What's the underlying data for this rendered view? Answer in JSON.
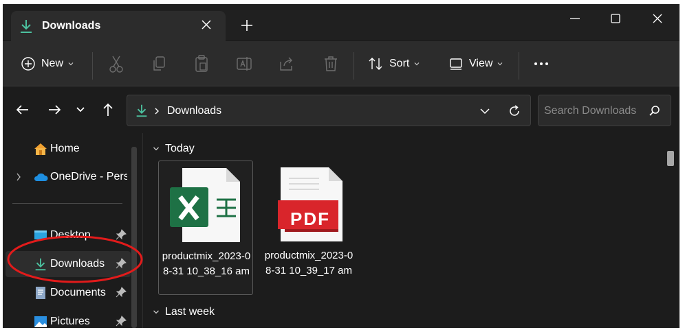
{
  "colors": {
    "accent": "#4cc2a0",
    "window_bg": "#1c1c1c",
    "annotation": "#e21b1b",
    "excel_green": "#1e7145",
    "pdf_red": "#d9252b"
  },
  "titlebar": {
    "tab_title": "Downloads",
    "tab_icon": "download-icon",
    "close_tab_icon": "close-icon",
    "new_tab_icon": "plus-icon",
    "window_controls": [
      "minimize-icon",
      "maximize-icon",
      "close-icon"
    ]
  },
  "commandbar": {
    "new_label": "New",
    "sort_label": "Sort",
    "view_label": "View",
    "icons": [
      "cut-icon",
      "copy-icon",
      "paste-icon",
      "rename-icon",
      "share-icon",
      "delete-icon",
      "more-icon"
    ]
  },
  "address": {
    "path": "Downloads",
    "search_placeholder": "Search Downloads"
  },
  "sidebar": {
    "items": [
      {
        "label": "Home",
        "icon": "home-icon"
      },
      {
        "label": "OneDrive - Perso",
        "icon": "cloud-icon"
      },
      {
        "label": "Desktop",
        "icon": "desktop-icon",
        "pinned": true
      },
      {
        "label": "Downloads",
        "icon": "download-icon",
        "pinned": true,
        "selected": true
      },
      {
        "label": "Documents",
        "icon": "documents-icon",
        "pinned": true
      },
      {
        "label": "Pictures",
        "icon": "pictures-icon",
        "pinned": true
      }
    ]
  },
  "main": {
    "groups": [
      {
        "label": "Today"
      },
      {
        "label": "Last week"
      }
    ],
    "files": [
      {
        "name": "productmix_2023-08-31 10_38_16 am",
        "type": "excel"
      },
      {
        "name": "productmix_2023-08-31 10_39_17 am",
        "type": "pdf",
        "badge": "PDF"
      }
    ]
  }
}
